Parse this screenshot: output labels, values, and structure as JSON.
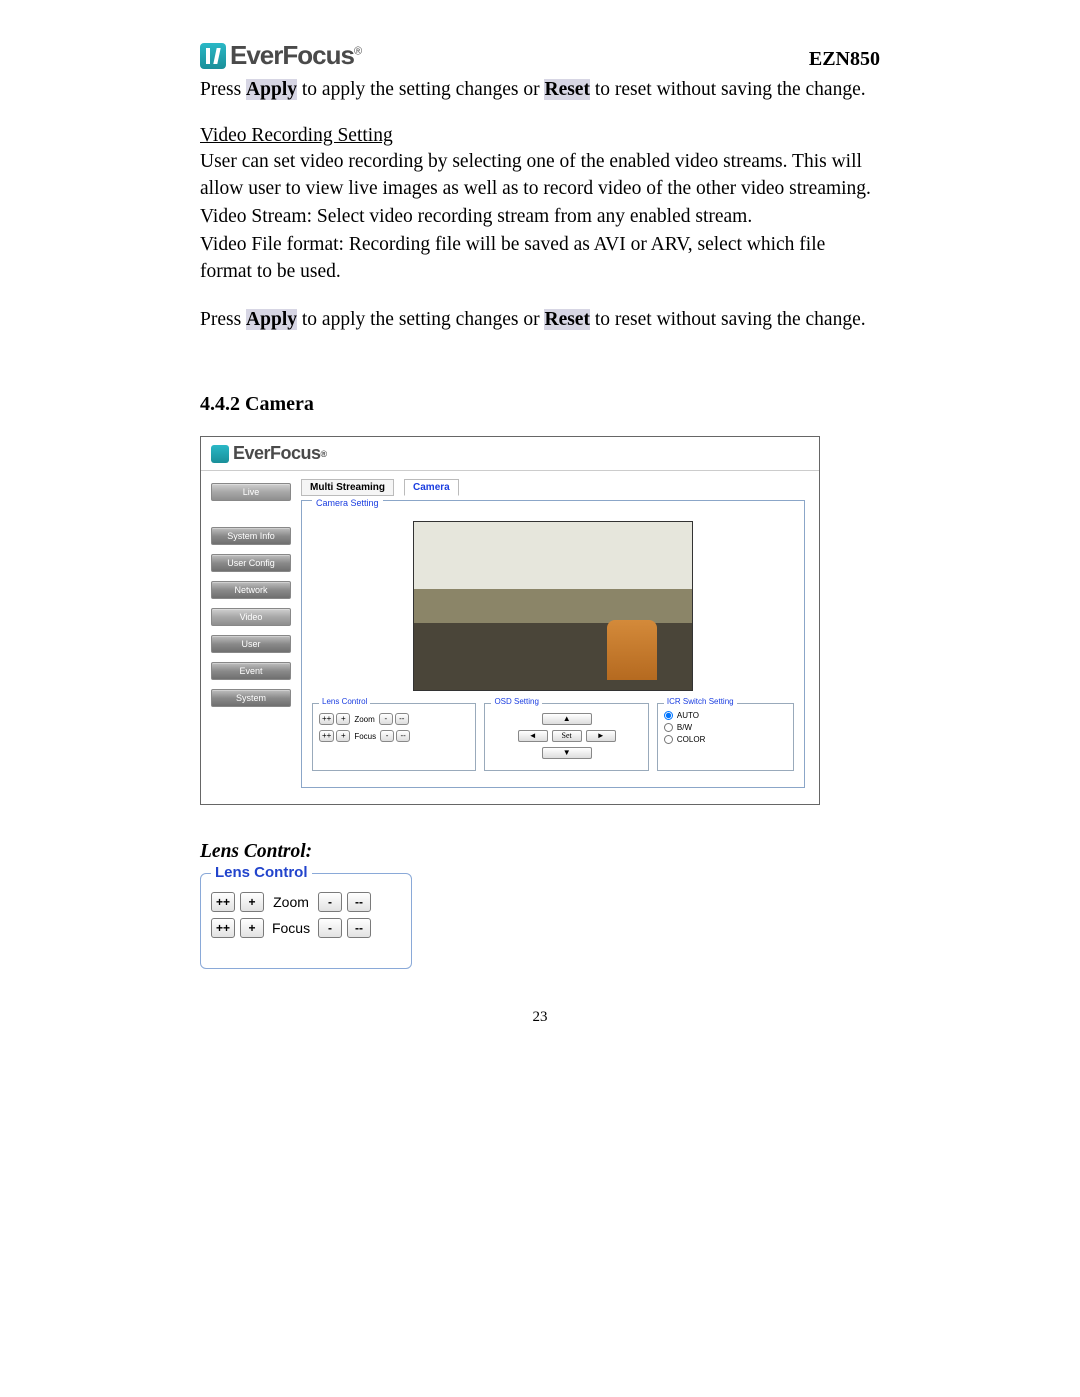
{
  "header": {
    "brand": "EverFocus",
    "registered": "®",
    "model": "EZN850"
  },
  "para1_pre": "Press ",
  "para1_apply": "Apply",
  "para1_mid": " to apply the setting changes or ",
  "para1_reset": "Reset",
  "para1_post": " to reset without saving the change.",
  "vr_heading": "Video Recording Setting",
  "vr_p1": "User can set video recording by selecting one of the enabled video streams. This will allow user to view live images as well as to record video of the other video streaming.",
  "vr_p2": "Video Stream: Select video recording stream from any enabled stream.",
  "vr_p3": "Video File format: Recording file will be saved as AVI or ARV, select which file format to be used.",
  "para2_pre": "Press ",
  "para2_apply": "Apply",
  "para2_mid": " to apply the setting changes or ",
  "para2_reset": "Reset",
  "para2_post": " to reset without saving the change.",
  "section_442": "4.4.2 Camera",
  "screenshot": {
    "brand": "EverFocus",
    "sidebar": {
      "live": "Live",
      "system_info": "System Info",
      "user_config": "User Config",
      "network": "Network",
      "video": "Video",
      "user": "User",
      "event": "Event",
      "system": "System"
    },
    "tabs": {
      "multi": "Multi Streaming",
      "camera": "Camera"
    },
    "camera_setting_label": "Camera Setting",
    "lens": {
      "title": "Lens Control",
      "zoom": "Zoom",
      "focus": "Focus"
    },
    "osd": {
      "title": "OSD Setting",
      "up": "▲",
      "down": "▼",
      "left": "◄",
      "right": "►",
      "set": "Set"
    },
    "icr": {
      "title": "ICR Switch Setting",
      "auto": "AUTO",
      "bw": "B/W",
      "color": "COLOR"
    }
  },
  "lens_heading": "Lens Control:",
  "lens_large": {
    "title": "Lens Control",
    "zoom": "Zoom",
    "focus": "Focus",
    "pp": "++",
    "p": "+",
    "m": "-",
    "mm": "--"
  },
  "page_number": "23"
}
